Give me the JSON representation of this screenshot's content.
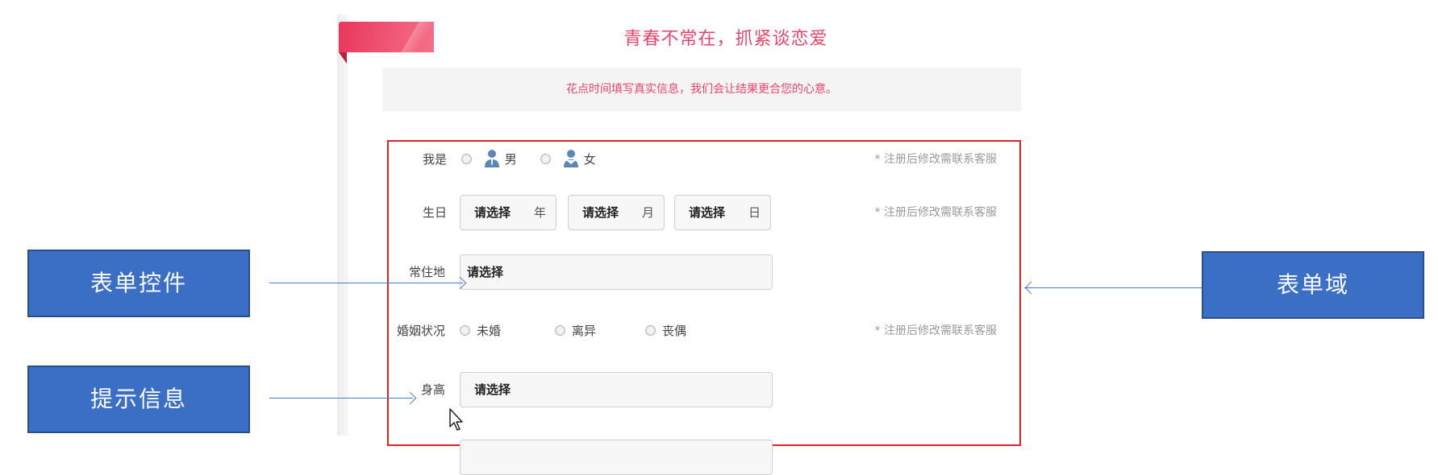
{
  "header": {
    "headline": "青春不常在，抓紧谈恋爱",
    "notice": "花点时间填写真实信息，我们会让结果更合您的心意。"
  },
  "form": {
    "gender": {
      "label": "我是",
      "options": [
        "男",
        "女"
      ],
      "hint": "* 注册后修改需联系客服"
    },
    "birthday": {
      "label": "生日",
      "selects": [
        {
          "value": "请选择",
          "unit": "年"
        },
        {
          "value": "请选择",
          "unit": "月"
        },
        {
          "value": "请选择",
          "unit": "日"
        }
      ],
      "hint": "* 注册后修改需联系客服"
    },
    "residence": {
      "label": "常住地",
      "value": "请选择"
    },
    "marital": {
      "label": "婚姻状况",
      "options": [
        "未婚",
        "离异",
        "丧偶"
      ],
      "hint": "* 注册后修改需联系客服"
    },
    "height": {
      "label": "身高",
      "value": "请选择"
    }
  },
  "annotations": {
    "form_control": "表单控件",
    "hint_info": "提示信息",
    "form_field": "表单域"
  },
  "colors": {
    "accent": "#e8456a",
    "form_border": "#e21f1f",
    "callout": "#3b6fc6"
  }
}
